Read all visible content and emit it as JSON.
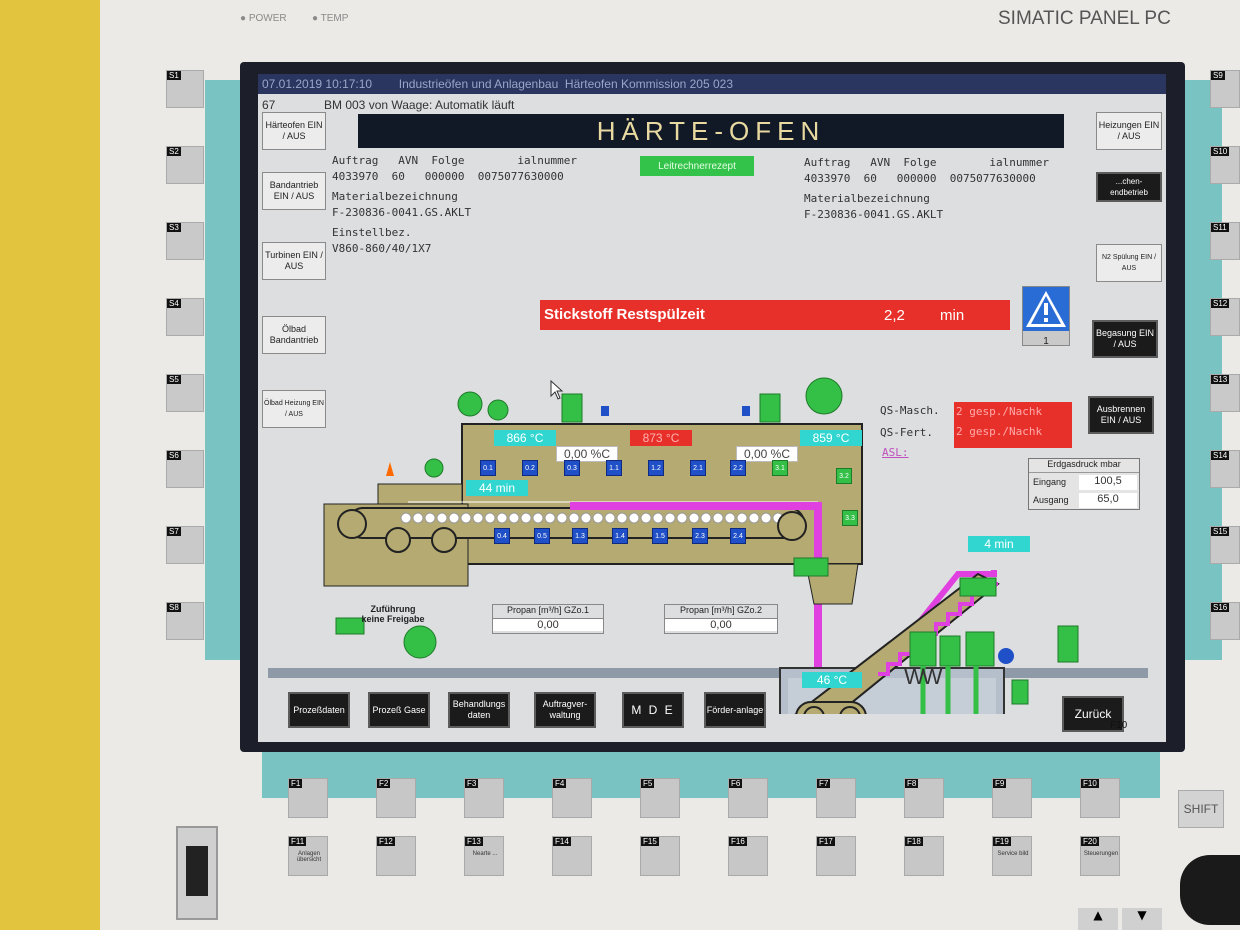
{
  "panel": {
    "led_power": "POWER",
    "led_temp": "TEMP",
    "brand": "SIMATIC PANEL PC",
    "shift": "SHIFT"
  },
  "side_keys_left": [
    "S1",
    "S2",
    "S3",
    "S4",
    "S5",
    "S6",
    "S7",
    "S8"
  ],
  "side_keys_right": [
    "S9",
    "S10",
    "S11",
    "S12",
    "S13",
    "S14",
    "S15",
    "S16"
  ],
  "fkeys_row1": [
    "F1",
    "F2",
    "F3",
    "F4",
    "F5",
    "F6",
    "F7",
    "F8",
    "F9",
    "F10"
  ],
  "fkeys_row2": [
    {
      "id": "F11",
      "label": "Anlagen übersicht"
    },
    {
      "id": "F12",
      "label": ""
    },
    {
      "id": "F13",
      "label": "Nearte ..."
    },
    {
      "id": "F14",
      "label": ""
    },
    {
      "id": "F15",
      "label": ""
    },
    {
      "id": "F16",
      "label": ""
    },
    {
      "id": "F17",
      "label": ""
    },
    {
      "id": "F18",
      "label": ""
    },
    {
      "id": "F19",
      "label": "Service bild"
    },
    {
      "id": "F20",
      "label": "Steuerungen"
    }
  ],
  "screen": {
    "topbar": "07.01.2019 10:17:10        Industrieöfen und Anlagenbau  Härteofen Kommission 205 023",
    "status_num": "67",
    "status_text": "BM 003 von Waage: Automatik läuft",
    "title": "HÄRTE-OFEN",
    "left_buttons": [
      {
        "label": "Härteofen EIN / AUS"
      },
      {
        "label": "Bandantrieb EIN / AUS"
      },
      {
        "label": "Turbinen EIN / AUS"
      },
      {
        "label": "Ölbad Bandantrieb"
      },
      {
        "label": "Ölbad Heizung EIN / AUS"
      }
    ],
    "right_buttons": [
      {
        "label": "Heizungen EIN / AUS",
        "dark": false
      },
      {
        "label": "...chen-endbetrieb",
        "dark": true
      },
      {
        "label": "N2 Spülung EIN / AUS",
        "dark": false
      },
      {
        "label": "Begasung EIN / AUS",
        "dark": true
      },
      {
        "label": "Ausbrennen EIN / AUS",
        "dark": true
      }
    ],
    "order_left": {
      "header": "Auftrag   AVN  Folge        ialnummer",
      "values": "4033970  60   000000  0075077630000",
      "mat_label": "Materialbezeichnung",
      "mat_value": "F-230836-0041.GS.AKLT",
      "einst_label": "Einstellbez.",
      "einst_value": "V860-860/40/1X7"
    },
    "order_right": {
      "header": "Auftrag   AVN  Folge        ialnummer",
      "values": "4033970  60   000000  0075077630000",
      "mat_label": "Materialbezeichnung",
      "mat_value": "F-230836-0041.GS.AKLT"
    },
    "leitrechner": "Leitrechnerrezept",
    "alarm": {
      "label": "Stickstoff Restspülzeit",
      "value": "2,2",
      "unit": "min"
    },
    "warn_count": "1",
    "furnace": {
      "temp1": "866 °C",
      "temp2": "873 °C",
      "temp3": "859 °C",
      "cp1": "0,00 %C",
      "cp2": "0,00 %C",
      "time_furnace": "44  min",
      "time_conveyor": "4  min",
      "oil_temp": "46  °C",
      "zones_top": [
        "0.1",
        "0.2",
        "0.3",
        "1.1",
        "1.2",
        "2.1",
        "2.2"
      ],
      "zones_top_green": [
        "3.1",
        "3.2",
        "3.3"
      ],
      "zones_bottom": [
        "0.4",
        "0.5",
        "1.3",
        "1.4",
        "1.5",
        "2.3",
        "2.4"
      ],
      "ww": "WW"
    },
    "qs": {
      "masch_label": "QS-Masch.",
      "masch_value": "2 gesp./Nachk",
      "fert_label": "QS-Fert.",
      "fert_value": "2 gesp./Nachk",
      "asl": "ASL:"
    },
    "gas": {
      "title": "Erdgasdruck mbar",
      "in_label": "Eingang",
      "in_value": "100,5",
      "out_label": "Ausgang",
      "out_value": "65,0"
    },
    "feed": {
      "line1": "Zuführung",
      "line2": "keine Freigabe"
    },
    "propan1": {
      "label": "Propan [m³/h] GZo.1",
      "value": "0,00"
    },
    "propan2": {
      "label": "Propan [m³/h] GZo.2",
      "value": "0,00"
    },
    "bottom_buttons": [
      "Prozeßdaten",
      "Prozeß Gase",
      "Behandlungs daten",
      "Auftragver-waltung",
      "M D E",
      "Förder-anlage"
    ],
    "back": {
      "label": "Zurück",
      "key": "F10"
    }
  },
  "colors": {
    "teal": "#79c3c3",
    "alarm_red": "#e8302a",
    "cyan": "#31d6d0",
    "magenta": "#e040e0",
    "zone_blue": "#2050c8",
    "zone_green": "#34c046",
    "khaki": "#b5aa72"
  }
}
